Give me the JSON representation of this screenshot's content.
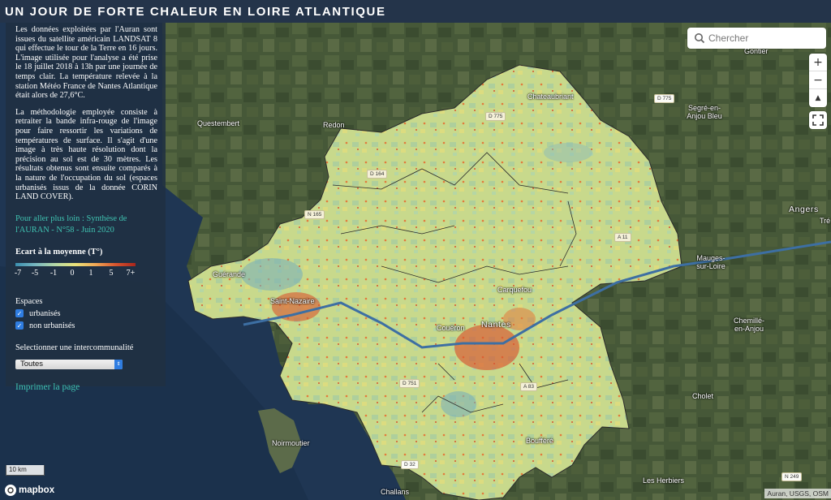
{
  "header": {
    "title": "UN JOUR DE FORTE CHALEUR EN LOIRE ATLANTIQUE"
  },
  "panel": {
    "paragraph1": "Les données exploitées par l'Auran sont issues du satellite américain LANDSAT 8 qui effectue le tour de la Terre en 16 jours. L'image utilisée pour l'analyse a été prise le 18 juillet 2018 à 13h par une journée de temps clair. La température relevée à la station Météo France de Nantes Atlantique était alors de 27,6°C.",
    "paragraph2": "La méthodologie employée consiste à retraiter la bande infra-rouge de l'image pour faire ressortir les variations de températures de surface. Il s'agit d'une image à très haute résolution dont la précision au sol est de 30 mètres. Les résultats obtenus sont ensuite comparés à la nature de l'occupation du sol (espaces urbanisés issus de la donnée CORIN LAND COVER).",
    "further_link": "Pour aller plus loin : Synthèse de l'AURAN - N°58 - Juin 2020",
    "legend_title": "Ecart à la moyenne (T°)",
    "legend_ticks": [
      "-7",
      "-5",
      "-1",
      "0",
      "1",
      "5",
      "7+"
    ],
    "legend_colors": [
      "#3b8fb0",
      "#78b7c0",
      "#b6d9a6",
      "#e9e27a",
      "#f0a855",
      "#d8552f",
      "#a8251c"
    ],
    "spaces_title": "Espaces",
    "checkbox_urban": "urbanisés",
    "checkbox_nonurban": "non urbanisés",
    "interco_title": "Selectionner une intercommunalité",
    "interco_selected": "Toutes",
    "print_link": "Imprimer la page"
  },
  "search": {
    "placeholder": "Chercher"
  },
  "zoom": {
    "in": "+",
    "out": "−",
    "north": "▲"
  },
  "map": {
    "places": {
      "gontier": "Gontier",
      "chateaubriant": "Chateaubriant",
      "segre": "Segré-en-\nAnjou Bleu",
      "questembert": "Questembert",
      "redon": "Redon",
      "angers": "Angers",
      "tre": "Tré",
      "mauges": "Mauges-\nsur-Loire",
      "guerande": "Guérande",
      "saint_nazaire": "Saint-Nazaire",
      "carquefou": "Carquefou",
      "nantes": "Nantes",
      "coueron": "Couëron",
      "chemille": "Chemillé-\nen-Anjou",
      "cholet": "Cholet",
      "noirmoutier": "Noirmoutier",
      "bouffere": "Boufféré",
      "herbiers": "Les Herbiers",
      "challans": "Challans"
    },
    "roads": {
      "d775_a": "D 775",
      "d775_b": "D 775",
      "d164": "D 164",
      "n165": "N 165",
      "a11": "A 11",
      "d751": "D 751",
      "a83": "A 83",
      "d32": "D 32",
      "n249": "N 249"
    }
  },
  "scale": "10 km",
  "logo": "mapbox",
  "attribution": "Auran, USGS, OSM"
}
